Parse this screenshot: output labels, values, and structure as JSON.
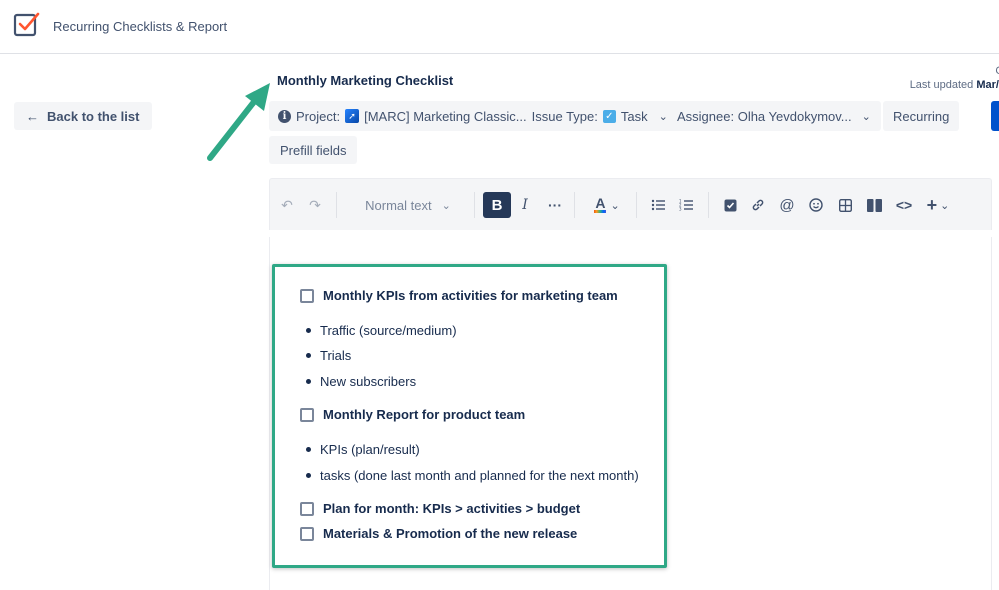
{
  "app": {
    "title": "Recurring Checklists & Report",
    "logo_icon": "checklist-icon"
  },
  "nav": {
    "back_label": "Back to the list",
    "back_icon": "arrow-left-icon"
  },
  "page": {
    "title": "Monthly Marketing Checklist",
    "created_label": "Cr",
    "last_updated_label": "Last updated",
    "last_updated_value": "Mar/"
  },
  "fields": {
    "project_label": "Project:",
    "project_value": "[MARC] Marketing Classic...",
    "issue_type_label": "Issue Type:",
    "issue_type_value": "Task",
    "assignee_label": "Assignee: Olha Yevdokymov...",
    "recurring_label": "Recurring",
    "prefill_label": "Prefill fields"
  },
  "toolbar": {
    "text_style": "Normal text",
    "bold": "B",
    "italic": "I",
    "more": "···",
    "text_color": "A",
    "icons": [
      "undo-icon",
      "redo-icon",
      "bold-icon",
      "italic-icon",
      "more-icon",
      "text-color-icon",
      "bullet-list-icon",
      "numbered-list-icon",
      "task-checkbox-icon",
      "link-icon",
      "mention-icon",
      "emoji-icon",
      "table-icon",
      "layout-icon",
      "code-icon",
      "insert-icon"
    ]
  },
  "checklist": {
    "items": [
      {
        "label": "Monthly KPIs from activities for marketing team",
        "checked": false
      },
      {
        "label": "Monthly Report for product team",
        "checked": false
      },
      {
        "label": "Plan for month: KPIs > activities > budget",
        "checked": false
      },
      {
        "label": "Materials & Promotion of the new release",
        "checked": false
      }
    ],
    "bullets_group1": [
      "Traffic (source/medium)",
      "Trials",
      "New subscribers"
    ],
    "bullets_group2": [
      "KPIs (plan/result)",
      "tasks (done last month and planned for the next month)"
    ]
  },
  "colors": {
    "annotation_green": "#2fa886",
    "primary_blue": "#0052cc",
    "bold_button_bg": "#253858"
  }
}
